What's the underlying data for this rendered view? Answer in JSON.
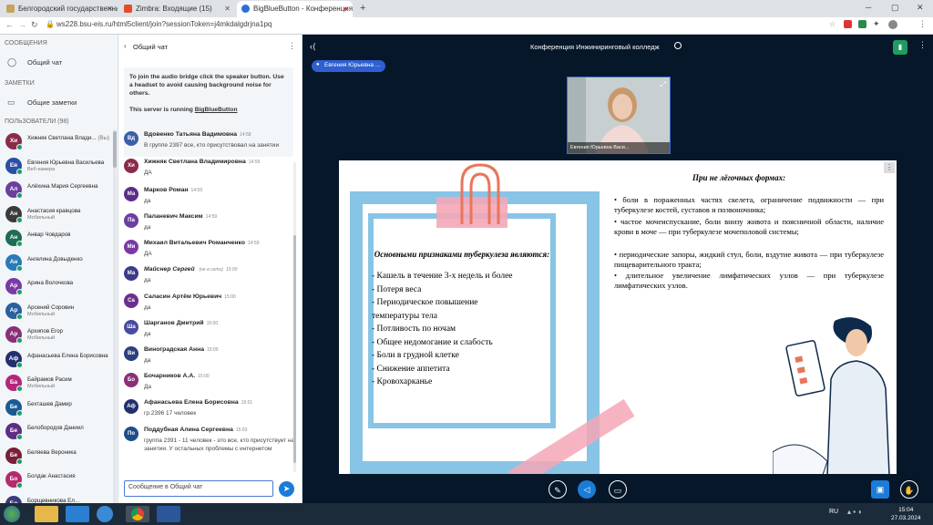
{
  "browser": {
    "tabs": [
      {
        "label": "Белгородский государственны...",
        "color": "#c4a35a"
      },
      {
        "label": "Zimbra: Входящие (15)",
        "color": "#e34b2a"
      },
      {
        "label": "BigBlueButton - Конференция...",
        "color": "#2a6fd6"
      }
    ],
    "new_tab": "+",
    "url": "ws228.bsu-eis.ru/html5client/join?sessionToken=j4mkdalgdrjna1pq"
  },
  "sidebar": {
    "messages_header": "СООБЩЕНИЯ",
    "public_chat": "Общий чат",
    "notes_header": "ЗАМЕТКИ",
    "shared_notes": "Общие заметки",
    "users_header": "ПОЛЬЗОВАТЕЛИ (98)",
    "users": [
      {
        "initials": "Хи",
        "name": "Хижняк Светлана Влади...",
        "sub": "",
        "tag": "(Вы)",
        "color": "#8b2b4a"
      },
      {
        "initials": "Ев",
        "name": "Евгения Юрьевна Васильева",
        "sub": "Веб-камера",
        "tag": "",
        "color": "#2a4fa8"
      },
      {
        "initials": "Ал",
        "name": "Алёхина Мария Сергеевна",
        "sub": "",
        "tag": "",
        "color": "#6b3fa0"
      },
      {
        "initials": "Ан",
        "name": "Анастасия кравцова",
        "sub": "Мобильный",
        "tag": "",
        "color": "#3b3b3b"
      },
      {
        "initials": "Ан",
        "name": "Анвар Човдаров",
        "sub": "",
        "tag": "",
        "color": "#1e6c54"
      },
      {
        "initials": "Ан",
        "name": "Ангелина Довыденко",
        "sub": "",
        "tag": "",
        "color": "#2a7ab8"
      },
      {
        "initials": "Ар",
        "name": "Арина Волочкова",
        "sub": "",
        "tag": "",
        "color": "#7a3aa6"
      },
      {
        "initials": "Ар",
        "name": "Арсений Соровин",
        "sub": "Мобильный",
        "tag": "",
        "color": "#2b5f9e"
      },
      {
        "initials": "Ар",
        "name": "Архипов Егор",
        "sub": "Мобильный",
        "tag": "",
        "color": "#8a2f78"
      },
      {
        "initials": "Аф",
        "name": "Афанасьева Елена Борисовна",
        "sub": "",
        "tag": "",
        "color": "#22306e"
      },
      {
        "initials": "Ба",
        "name": "Байрамов Расим",
        "sub": "Мобильный",
        "tag": "",
        "color": "#b5267a"
      },
      {
        "initials": "Бе",
        "name": "Бехташев Дамир",
        "sub": "",
        "tag": "",
        "color": "#1a5b93"
      },
      {
        "initials": "Бе",
        "name": "Белобородов Даниил",
        "sub": "",
        "tag": "",
        "color": "#5d2d86"
      },
      {
        "initials": "Бе",
        "name": "Беляева Вероника",
        "sub": "",
        "tag": "",
        "color": "#7a1e3a"
      },
      {
        "initials": "Бо",
        "name": "Болдак Анастасия",
        "sub": "",
        "tag": "",
        "color": "#b52a6b"
      },
      {
        "initials": "Бо",
        "name": "Борщевникова Ел...",
        "sub": "",
        "tag": "",
        "color": "#3a3a7a"
      }
    ]
  },
  "chat": {
    "title": "Общий чат",
    "welcome_1": "To join the audio bridge click the speaker button. Use a headset to avoid causing background noise for others.",
    "welcome_2": "This server is running ",
    "welcome_link": "BigBlueButton",
    "messages": [
      {
        "initials": "Вд",
        "name": "Вдовенко Татьяна Вадимовна",
        "time": "14:58",
        "text": "В группе 2397 все, кто присутствовал на занятии",
        "color": "#3b5fa8",
        "italic": false
      },
      {
        "initials": "Хи",
        "name": "Хижняк Светлана Владимировна",
        "time": "14:59",
        "text": "ДА",
        "color": "#8b2b4a",
        "italic": false
      },
      {
        "initials": "Ма",
        "name": "Марков Роман",
        "time": "14:59",
        "text": "да",
        "color": "#5d2d86",
        "italic": false
      },
      {
        "initials": "Па",
        "name": "Паланевич Максим",
        "time": "14:59",
        "text": "да",
        "color": "#6b3fa0",
        "italic": false
      },
      {
        "initials": "Ми",
        "name": "Михаил Витальевич Романченко",
        "time": "14:59",
        "text": "ДА",
        "color": "#7a3aa6",
        "italic": false
      },
      {
        "initials": "Ма",
        "name": "Майснер Сергей",
        "time": "15:00",
        "text": "да",
        "color": "#3b3b8a",
        "italic": true,
        "note": "(не в сети)"
      },
      {
        "initials": "Са",
        "name": "Саласин Артём Юрьевич",
        "time": "15:00",
        "text": "да",
        "color": "#6a2f8e",
        "italic": false
      },
      {
        "initials": "Ша",
        "name": "Шарганов Дмитрий",
        "time": "15:00",
        "text": "да",
        "color": "#4a4aa0",
        "italic": false
      },
      {
        "initials": "Ви",
        "name": "Виноградская Анна",
        "time": "15:00",
        "text": "да",
        "color": "#2b3f7e",
        "italic": false
      },
      {
        "initials": "Бо",
        "name": "Бочарников А.А.",
        "time": "15:00",
        "text": "Да",
        "color": "#8a2f78",
        "italic": false
      },
      {
        "initials": "Аф",
        "name": "Афанасьева Елена Борисовна",
        "time": "15:01",
        "text": "гр.2396 17 человек",
        "color": "#22306e",
        "italic": false
      },
      {
        "initials": "По",
        "name": "Поддубная Алина Сергеевна",
        "time": "15:03",
        "text": "группа 2391 - 11 человек - это все, кто присутствует на занятии. У остальных проблемы с интернетом",
        "color": "#1e4e8a",
        "italic": false
      }
    ],
    "input_placeholder": "Сообщение в Общий чат"
  },
  "main": {
    "conference_title": "Конференция Инжиниринговый колледж",
    "presenter": "Евгения Юрьевна ...",
    "webcam_label": "Евгения Юрьевна Васи...",
    "slide": {
      "left_title": "Основными признаками туберкулеза являются:",
      "symptoms": [
        "- Кашель в течение 3-х недель и более",
        "- Потеря веса",
        "- Периодическое повышение",
        "температуры тела",
        "- Потливость по ночам",
        "- Общее недомогание и слабость",
        "- Боли в грудной клетке",
        "- Снижение аппетита",
        "- Кровохарканье"
      ],
      "right_title": "При не лёгочных формах:",
      "right_points": [
        "• боли в пораженных частях скелета, ограничение подвижности — при туберкулезе костей, суставов и позвоночника;",
        "• частое мочеиспускание, боли внизу живота и поясничной области, наличие крови в моче — при туберкулезе мочеполовой системы;",
        "• периодические запоры, жидкий стул, боли, вздутие живота — при туберкулезе пищеварительного тракта;",
        "• длительное увеличение лимфатических узлов — при туберкулезе лимфатических узлов."
      ]
    }
  },
  "taskbar": {
    "lang": "RU",
    "time": "15:04",
    "date": "27.03.2024"
  },
  "colors": {
    "accent": "#1b7cd8",
    "stamp": "#88c4e6",
    "clip": "#e8765a",
    "pink": "#f08aa0"
  }
}
